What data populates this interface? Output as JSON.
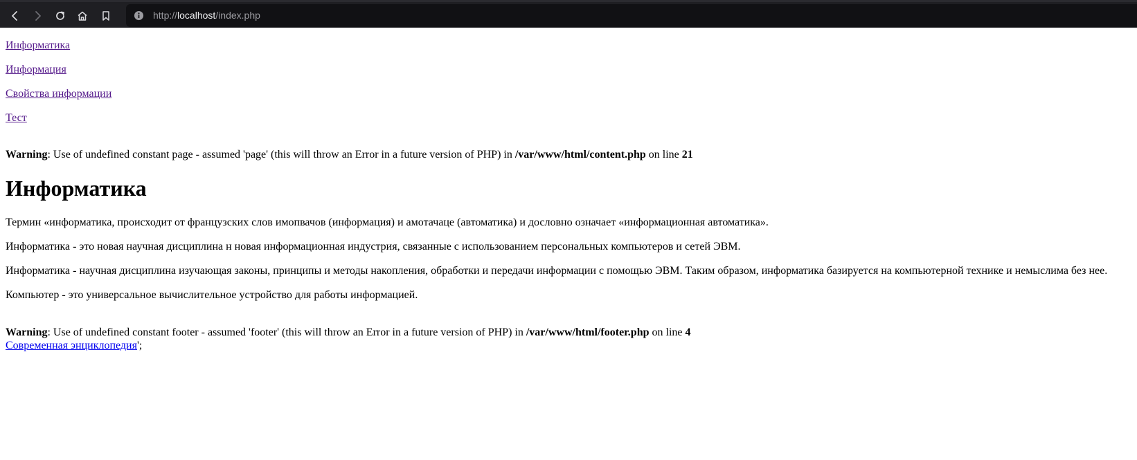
{
  "browser": {
    "url": {
      "protocol": "http://",
      "host": "localhost",
      "path": "/index.php"
    },
    "icons": {
      "back": "arrow-left-icon",
      "forward": "arrow-right-icon",
      "reload": "reload-icon",
      "home": "home-icon",
      "bookmark": "bookmark-icon",
      "info": "info-icon"
    }
  },
  "menu": [
    {
      "label": "Информатика"
    },
    {
      "label": "Информация"
    },
    {
      "label": "Свойства информации"
    },
    {
      "label": "Тест"
    }
  ],
  "warning1": {
    "label": "Warning",
    "message": ": Use of undefined constant page - assumed 'page' (this will throw an Error in a future version of PHP) in ",
    "file": "/var/www/html/content.php",
    "on_line": " on line ",
    "line": "21"
  },
  "article": {
    "title": "Информатика",
    "paragraphs": [
      "Термин «информатика, происходит от французских слов имопвачов (информация) и амотачаце (автоматика) и дословно означает «информационная автоматика».",
      "Информатика - это новая научная дисциплина н новая информационная индустрия, связанные с использованием персональных компьютеров и сетей ЭВМ.",
      "Информатика - научная дисциплина изучающая законы, принципы и методы накопления, обработки и передачи информации с помощью ЭВМ. Таким образом, информатика базируется на компьютерной технике и немыслима без нее.",
      "Компьютер - это универсальное вычислительное устройство для работы информацией."
    ]
  },
  "warning2": {
    "label": "Warning",
    "message": ": Use of undefined constant footer - assumed 'footer' (this will throw an Error in a future version of PHP) in ",
    "file": "/var/www/html/footer.php",
    "on_line": " on line ",
    "line": "4"
  },
  "footer": {
    "link": "Современная энциклопедия",
    "trailing": "';"
  },
  "colors": {
    "toolbar_bg": "#1f1f23",
    "urlbar_bg": "#111114",
    "visited_link": "#551a8b",
    "link": "#0000ee"
  }
}
